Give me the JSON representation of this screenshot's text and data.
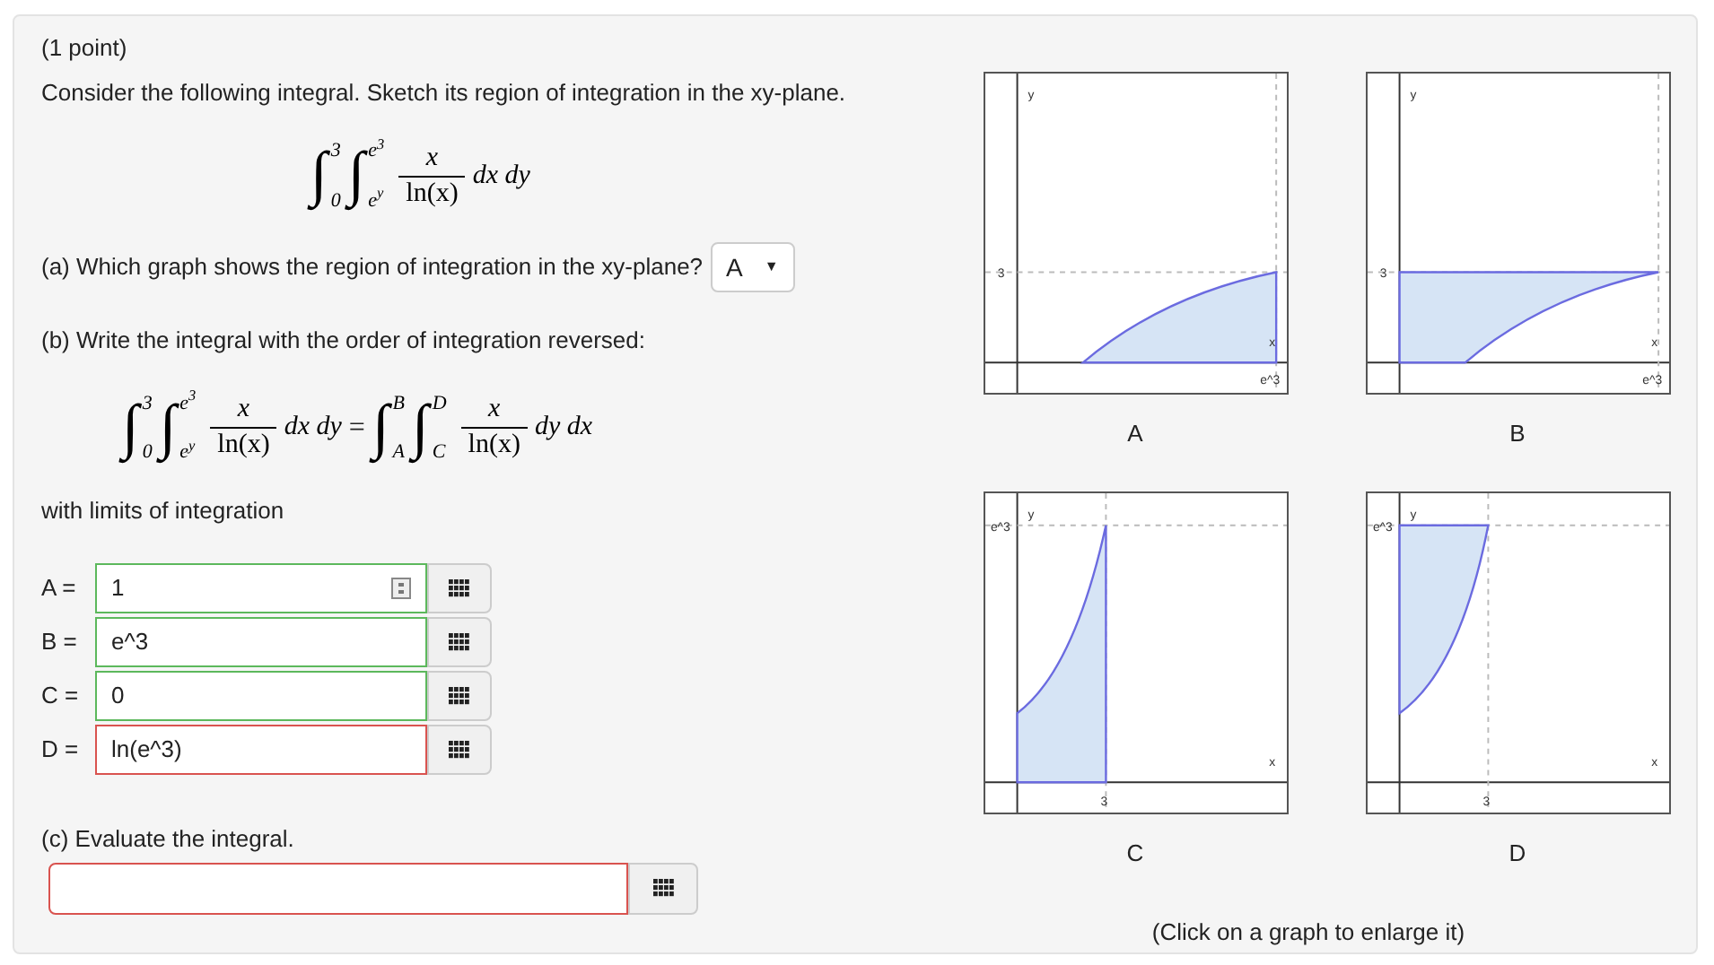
{
  "points": "(1 point)",
  "prompt": "Consider the following integral. Sketch its region of integration in the xy-plane.",
  "integral": {
    "terms": [
      {
        "sign": "∫",
        "lower": "0",
        "upper": "3"
      },
      {
        "sign": "∫",
        "lower": "e$^{y}$",
        "upper": "e$^{3}$"
      }
    ],
    "numerator": "x",
    "denominator": "ln(x)",
    "differentials": "dx dy"
  },
  "part_a": {
    "question": "(a) Which graph shows the region of integration in the xy-plane?",
    "dropdown": "A",
    "caret": "▼"
  },
  "part_b": {
    "question": "(b) Write the integral with the order of integration reversed:",
    "left": {
      "terms": [
        {
          "sign": "∫",
          "lower": "0",
          "upper": "3"
        },
        {
          "sign": "∫",
          "lower": "e$^{y}$",
          "upper": "e$^{3}$"
        }
      ],
      "numerator": "x",
      "denominator": "ln(x)",
      "differentials": "dx dy"
    },
    "equals": "=",
    "right": {
      "terms": [
        {
          "sign": "∫",
          "lower": "A",
          "upper": "B"
        },
        {
          "sign": "∫",
          "lower": "C",
          "upper": "D"
        }
      ],
      "numerator": "x",
      "denominator": "ln(x)",
      "differentials": "dy dx"
    },
    "limits_label": "with limits of integration",
    "fields": [
      {
        "label": "A =",
        "value": "1",
        "correct": true,
        "preview": true
      },
      {
        "label": "B =",
        "value": "e^3",
        "correct": true,
        "preview": false
      },
      {
        "label": "C =",
        "value": "0",
        "correct": true,
        "preview": false
      },
      {
        "label": "D =",
        "value": "ln(e^3)",
        "correct": false,
        "preview": false
      }
    ]
  },
  "part_c": {
    "question": "(c) Evaluate the integral.",
    "correct": false
  },
  "graphs": [
    {
      "kind": "under-log",
      "y_label": "y",
      "x_label": "x",
      "tick": "3",
      "tick2": "e^3",
      "caption": "A"
    },
    {
      "kind": "over-log",
      "y_label": "y",
      "x_label": "x",
      "tick": "3",
      "tick2": "e^3",
      "caption": "B"
    },
    {
      "kind": "under-exp",
      "y_label": "y",
      "x_label": "x",
      "tick": "3",
      "tick2": "e^3",
      "caption": "C"
    },
    {
      "kind": "over-exp",
      "y_label": "y",
      "x_label": "x",
      "tick": "3",
      "tick2": "e^3",
      "caption": "D"
    }
  ],
  "graph_hint": "(Click on a graph to enlarge it)"
}
